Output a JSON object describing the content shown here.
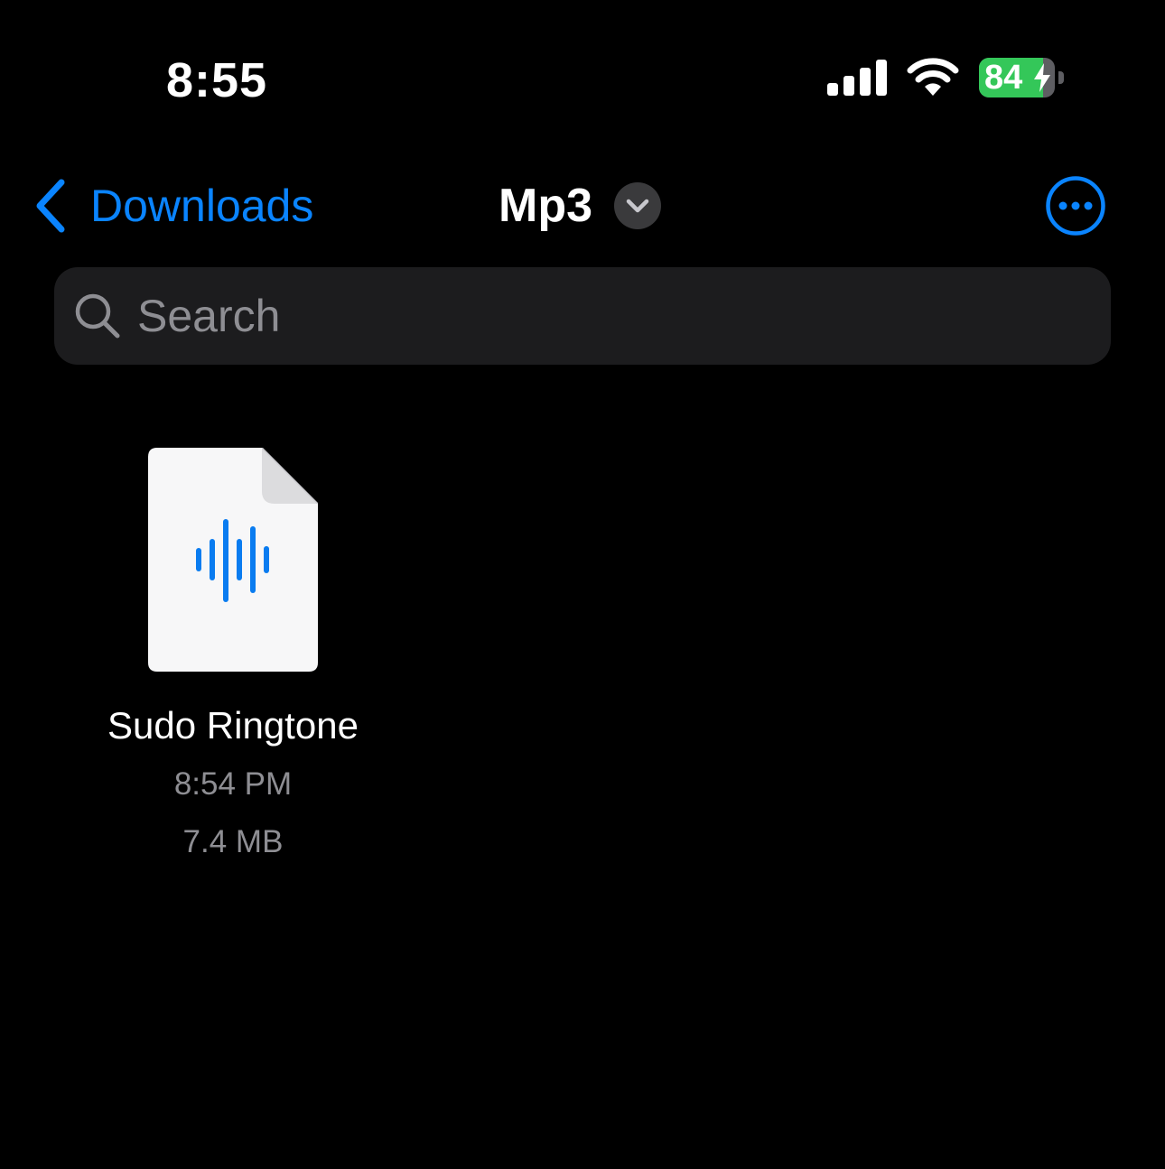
{
  "status_bar": {
    "time": "8:55",
    "battery_level": "84",
    "battery_fraction": 0.84,
    "icons": [
      "cellular-signal-icon",
      "wifi-icon",
      "battery-charging-icon"
    ]
  },
  "nav": {
    "back_label": "Downloads",
    "title": "Mp3",
    "icons": [
      "chevron-left-icon",
      "chevron-down-icon",
      "more-icon"
    ]
  },
  "search": {
    "placeholder": "Search",
    "value": ""
  },
  "files": [
    {
      "name": "Sudo Ringtone",
      "date": "8:54 PM",
      "size": "7.4 MB",
      "icon": "audio-file-icon"
    }
  ],
  "colors": {
    "accent": "#0a84ff",
    "battery_green": "#34c759",
    "secondary_text": "#8e8e93",
    "search_bg": "#1c1c1e",
    "background": "#000000"
  }
}
